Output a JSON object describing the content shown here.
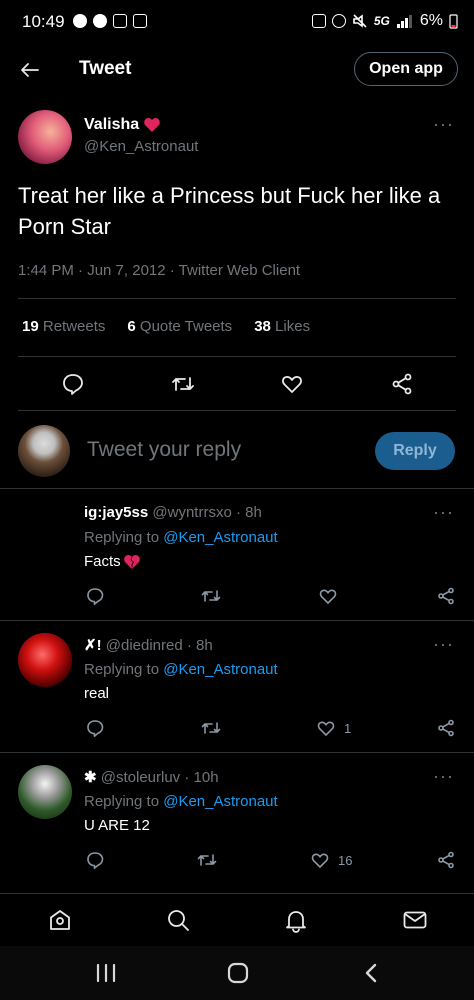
{
  "status_bar": {
    "time": "10:49",
    "battery": "6%",
    "network": "5G"
  },
  "header": {
    "title": "Tweet",
    "open_app": "Open app"
  },
  "tweet": {
    "author_name": "Valisha",
    "author_handle": "@Ken_Astronaut",
    "text": "Treat her like a Princess but Fuck her like a Porn Star",
    "meta": "1:44 PM · Jun 7, 2012 · Twitter Web Client",
    "retweets_count": "19",
    "retweets_label": "Retweets",
    "quotes_count": "6",
    "quotes_label": "Quote Tweets",
    "likes_count": "38",
    "likes_label": "Likes",
    "more": "···"
  },
  "composer": {
    "placeholder": "Tweet your reply",
    "button": "Reply"
  },
  "replies": [
    {
      "name": "ig:jay5ss",
      "handle": "@wyntrrsxo",
      "time": "· 8h",
      "replying_prefix": "Replying to",
      "replying_to": "@Ken_Astronaut",
      "text": "Facts",
      "likes": ""
    },
    {
      "name": "✗!",
      "handle": "@diedinred",
      "time": "· 8h",
      "replying_prefix": "Replying to",
      "replying_to": "@Ken_Astronaut",
      "text": "real",
      "likes": "1"
    },
    {
      "name": "✱",
      "handle": "@stoleurluv",
      "time": "· 10h",
      "replying_prefix": "Replying to",
      "replying_to": "@Ken_Astronaut",
      "text": "U ARE 12",
      "likes": "16"
    }
  ],
  "colors": {
    "background": "#000000",
    "accent": "#1d9bf0",
    "muted": "#71767b",
    "heart": "#f91880"
  }
}
